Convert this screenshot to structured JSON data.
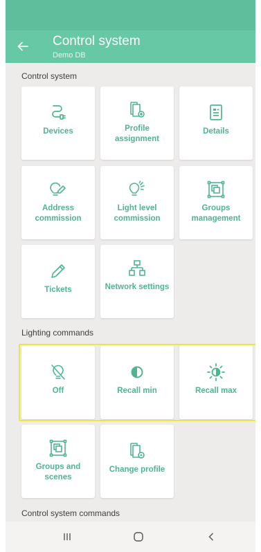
{
  "appbar": {
    "title": "Control system",
    "subtitle": "Demo DB"
  },
  "sections": {
    "control_system": "Control system",
    "lighting_commands": "Lighting commands",
    "control_system_commands": "Control system commands"
  },
  "control_tiles": [
    {
      "label": "Devices",
      "icon": "plug-icon"
    },
    {
      "label": "Profile assignment",
      "icon": "profile-assign-icon"
    },
    {
      "label": "Details",
      "icon": "document-icon"
    },
    {
      "label": "Address commission",
      "icon": "bulb-pencil-icon"
    },
    {
      "label": "Light level commission",
      "icon": "bulb-light-icon"
    },
    {
      "label": "Groups management",
      "icon": "groups-icon"
    },
    {
      "label": "Tickets",
      "icon": "pencil-icon"
    },
    {
      "label": "Network settings",
      "icon": "network-icon"
    }
  ],
  "lighting_tiles": [
    {
      "label": "Off",
      "icon": "bulb-off-icon"
    },
    {
      "label": "Recall min",
      "icon": "half-circle-icon"
    },
    {
      "label": "Recall max",
      "icon": "sun-icon"
    },
    {
      "label": "Groups and scenes",
      "icon": "groups-icon"
    },
    {
      "label": "Change profile",
      "icon": "profile-settings-icon"
    }
  ],
  "colors": {
    "accent": "#66c8a4",
    "status": "#5fbf9c",
    "label": "#4fb58f",
    "highlight": "#ece73b"
  }
}
